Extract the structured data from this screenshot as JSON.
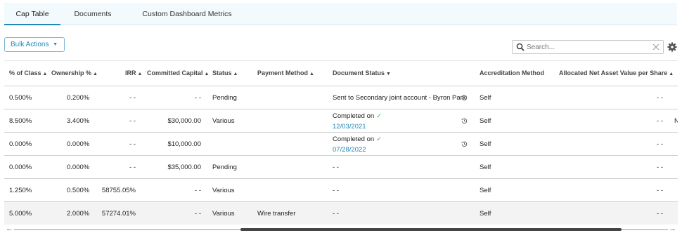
{
  "tabs": [
    {
      "label": "Cap Table",
      "active": true
    },
    {
      "label": "Documents",
      "active": false
    },
    {
      "label": "Custom Dashboard Metrics",
      "active": false
    }
  ],
  "toolbar": {
    "bulk_actions_label": "Bulk Actions",
    "search_placeholder": "Search...",
    "search_value": ""
  },
  "columns": [
    {
      "label": "% of Class",
      "sort": "▲"
    },
    {
      "label": "Ownership %",
      "sort": "▲"
    },
    {
      "label": "IRR",
      "sort": "▲"
    },
    {
      "label": "Committed Capital",
      "sort": "▲"
    },
    {
      "label": "Status",
      "sort": "▲"
    },
    {
      "label": "Payment Method",
      "sort": "▲"
    },
    {
      "label": "Document Status",
      "sort": "▼"
    },
    {
      "label": "Accreditation Method",
      "sort": ""
    },
    {
      "label": "Allocated Net Asset Value per Share",
      "sort": "▲"
    }
  ],
  "rows": [
    {
      "pct_class": "0.500%",
      "ownership": "0.200%",
      "irr": "- -",
      "committed": "- -",
      "status": "Pending",
      "payment": "",
      "doc_line1": "Sent to Secondary joint account - Byron Park",
      "doc_check": "",
      "doc_date": "",
      "accreditation": "Self",
      "nav": "- -",
      "extra": ""
    },
    {
      "pct_class": "8.500%",
      "ownership": "3.400%",
      "irr": "- -",
      "committed": "$30,000.00",
      "status": "Various",
      "payment": "",
      "doc_line1": "Completed on",
      "doc_check": "✓",
      "doc_date": "12/03/2021",
      "accreditation": "Self",
      "nav": "- -",
      "extra": "N"
    },
    {
      "pct_class": "0.000%",
      "ownership": "0.000%",
      "irr": "- -",
      "committed": "$10,000.00",
      "status": "",
      "payment": "",
      "doc_line1": "Completed on",
      "doc_check": "✓",
      "doc_date": "07/28/2022",
      "accreditation": "Self",
      "nav": "- -",
      "extra": ""
    },
    {
      "pct_class": "0.000%",
      "ownership": "0.000%",
      "irr": "- -",
      "committed": "$35,000.00",
      "status": "Pending",
      "payment": "",
      "doc_line1": "- -",
      "doc_check": "",
      "doc_date": "",
      "accreditation": "Self",
      "nav": "- -",
      "extra": ""
    },
    {
      "pct_class": "1.250%",
      "ownership": "0.500%",
      "irr": "58755.05%",
      "committed": "- -",
      "status": "Various",
      "payment": "",
      "doc_line1": "- -",
      "doc_check": "",
      "doc_date": "",
      "accreditation": "Self",
      "nav": "- -",
      "extra": ""
    },
    {
      "pct_class": "5.000%",
      "ownership": "2.000%",
      "irr": "57274.01%",
      "committed": "- -",
      "status": "Various",
      "payment": "Wire transfer",
      "doc_line1": "- -",
      "doc_check": "",
      "doc_date": "",
      "accreditation": "Self",
      "nav": "- -",
      "extra": ""
    }
  ],
  "scrollbar": {
    "left_arrow": "←",
    "right_arrow": "→"
  },
  "colors": {
    "accent": "#1f88b8",
    "check": "#45b649",
    "tabbar_bg": "#f2fafd"
  }
}
